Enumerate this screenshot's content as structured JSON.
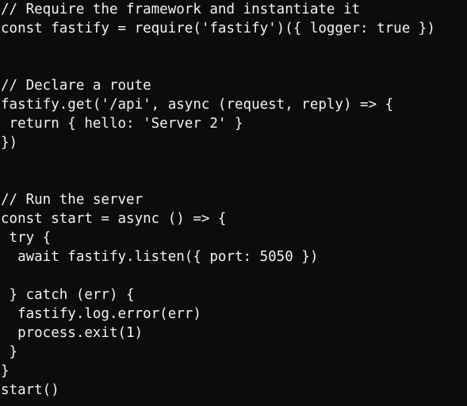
{
  "editor": {
    "lines": [
      "// Require the framework and instantiate it",
      "const fastify = require('fastify')({ logger: true })",
      "",
      "",
      "// Declare a route",
      "fastify.get('/api', async (request, reply) => {",
      " return { hello: 'Server 2' }",
      "})",
      "",
      "",
      "// Run the server",
      "const start = async () => {",
      " try {",
      "  await fastify.listen({ port: 5050 })",
      "",
      " } catch (err) {",
      "  fastify.log.error(err)",
      "  process.exit(1)",
      " }",
      "}",
      "start()"
    ]
  },
  "colors": {
    "background": "#0c0c0c",
    "text": "#f2f2f2",
    "prompt_user": "#16c60c",
    "prompt_path": "#3b78ff"
  }
}
